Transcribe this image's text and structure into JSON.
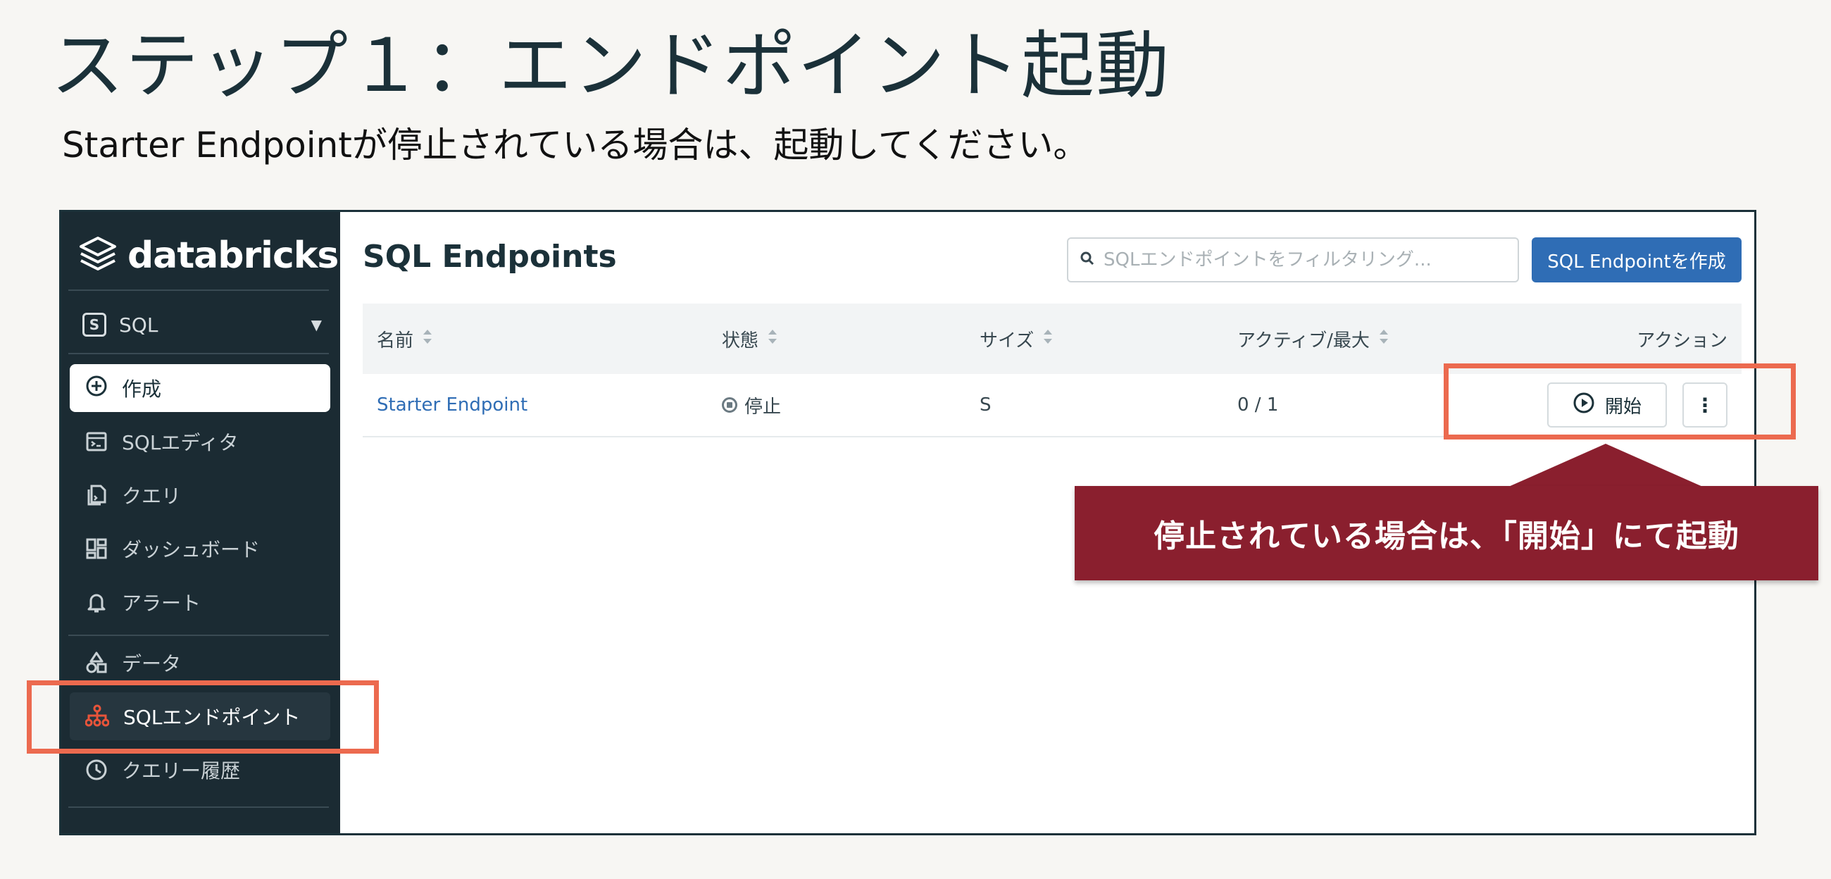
{
  "slide": {
    "title": "ステップ１：エンドポイント起動",
    "subtitle": "Starter Endpointが停止されている場合は、起動してください。"
  },
  "sidebar": {
    "logo": "databricks",
    "persona": "SQL",
    "persona_badge": "S",
    "create": "作成",
    "items": [
      {
        "label": "SQLエディタ",
        "icon": "sql-editor-icon"
      },
      {
        "label": "クエリ",
        "icon": "query-icon"
      },
      {
        "label": "ダッシュボード",
        "icon": "dashboard-icon"
      },
      {
        "label": "アラート",
        "icon": "bell-icon"
      },
      {
        "label": "データ",
        "icon": "data-icon"
      },
      {
        "label": "SQLエンドポイント",
        "icon": "endpoint-icon",
        "active": true
      },
      {
        "label": "クエリー履歴",
        "icon": "clock-icon"
      }
    ]
  },
  "main": {
    "title": "SQL Endpoints",
    "search_placeholder": "SQLエンドポイントをフィルタリング...",
    "create_button": "SQL Endpointを作成",
    "columns": [
      "名前",
      "状態",
      "サイズ",
      "アクティブ/最大",
      "アクション"
    ],
    "rows": [
      {
        "name": "Starter Endpoint",
        "status": "停止",
        "size": "S",
        "active_max": "0 / 1",
        "start_label": "開始",
        "more": "⋮"
      }
    ]
  },
  "callout": "停止されている場合は、「開始」にて起動",
  "colors": {
    "sidebar_bg": "#1b2b33",
    "accent_blue": "#2f6db5",
    "highlight": "#ec6a4f",
    "callout_bg": "#8a1f2e",
    "endpoint_icon": "#e8543a"
  }
}
